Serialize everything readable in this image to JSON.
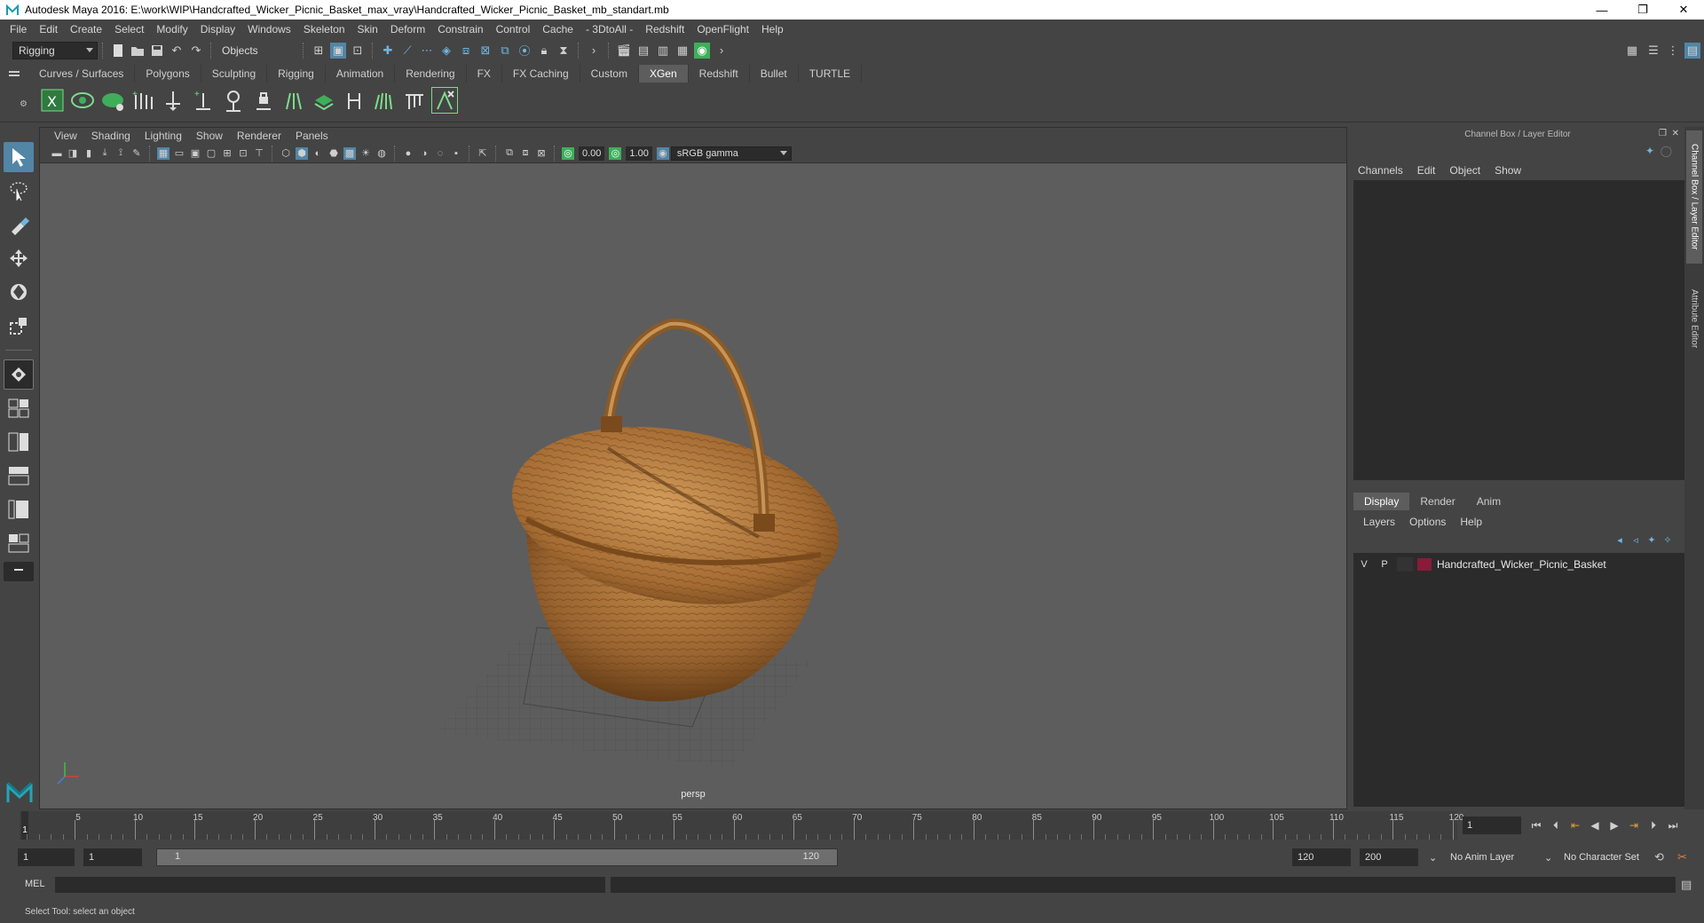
{
  "window": {
    "title": "Autodesk Maya 2016: E:\\work\\WIP\\Handcrafted_Wicker_Picnic_Basket_max_vray\\Handcrafted_Wicker_Picnic_Basket_mb_standart.mb",
    "minimize": "—",
    "maximize": "❐",
    "close": "✕"
  },
  "menubar": [
    "File",
    "Edit",
    "Create",
    "Select",
    "Modify",
    "Display",
    "Windows",
    "Skeleton",
    "Skin",
    "Deform",
    "Constrain",
    "Control",
    "Cache",
    "- 3DtoAll -",
    "Redshift",
    "OpenFlight",
    "Help"
  ],
  "statusline": {
    "menuset": "Rigging",
    "selection_mode": "Objects"
  },
  "shelf": {
    "tabs": [
      "Curves / Surfaces",
      "Polygons",
      "Sculpting",
      "Rigging",
      "Animation",
      "Rendering",
      "FX",
      "FX Caching",
      "Custom",
      "XGen",
      "Redshift",
      "Bullet",
      "TURTLE"
    ],
    "active_tab": "XGen"
  },
  "viewport": {
    "menu": [
      "View",
      "Shading",
      "Lighting",
      "Show",
      "Renderer",
      "Panels"
    ],
    "exposure": "0.00",
    "gamma": "1.00",
    "color_space": "sRGB gamma",
    "camera_label": "persp"
  },
  "channel_box": {
    "title": "Channel Box / Layer Editor",
    "menu": [
      "Channels",
      "Edit",
      "Object",
      "Show"
    ]
  },
  "layer_editor": {
    "tabs": [
      "Display",
      "Render",
      "Anim"
    ],
    "active_tab": "Display",
    "menu": [
      "Layers",
      "Options",
      "Help"
    ],
    "layers": [
      {
        "visible": "V",
        "playback": "P",
        "name": "Handcrafted_Wicker_Picnic_Basket",
        "color": "#8b1a3a"
      }
    ]
  },
  "side_tabs": [
    "Channel Box / Layer Editor",
    "Attribute Editor"
  ],
  "time_slider": {
    "tick_labels": [
      "1",
      "5",
      "10",
      "15",
      "20",
      "25",
      "30",
      "35",
      "40",
      "45",
      "50",
      "55",
      "60",
      "65",
      "70",
      "75",
      "80",
      "85",
      "90",
      "95",
      "100",
      "105",
      "110",
      "115",
      "120"
    ],
    "current_frame": "1"
  },
  "range_slider": {
    "start_time": "1",
    "playback_start": "1",
    "range_start_label": "1",
    "range_end_label": "120",
    "playback_end": "120",
    "end_time": "200",
    "anim_layer": "No Anim Layer",
    "character_set": "No Character Set"
  },
  "command_line": {
    "label": "MEL"
  },
  "help_line": {
    "text": "Select Tool: select an object"
  },
  "colors": {
    "accent": "#5285a6",
    "xgen_green": "#3fae5a",
    "layer_color": "#8b1a3a"
  }
}
